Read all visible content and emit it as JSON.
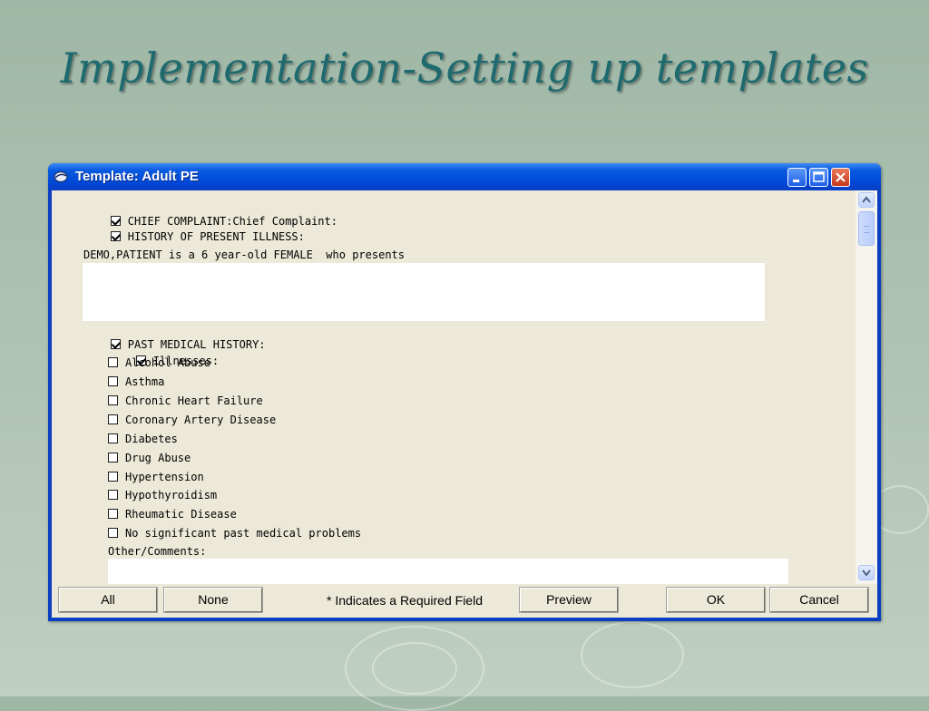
{
  "slide": {
    "title": "Implementation-Setting up templates"
  },
  "window": {
    "title": "Template: Adult PE",
    "controls": {
      "minimize_icon": "minimize-icon",
      "maximize_icon": "maximize-icon",
      "close_icon": "close-icon"
    }
  },
  "template": {
    "chief_complaint": {
      "label": "CHIEF COMPLAINT:Chief Complaint:",
      "checked": true
    },
    "hpi": {
      "label": "HISTORY OF PRESENT ILLNESS:",
      "checked": true,
      "intro": "DEMO,PATIENT is a 6 year-old FEMALE  who presents",
      "text_value": ""
    },
    "pmh": {
      "label": "PAST MEDICAL HISTORY:",
      "checked": true,
      "illnesses": {
        "label": "Illnesses:",
        "checked": true,
        "items": [
          {
            "label": "Alcohol Abuse",
            "checked": false
          },
          {
            "label": "Asthma",
            "checked": false
          },
          {
            "label": "Chronic Heart Failure",
            "checked": false
          },
          {
            "label": "Coronary Artery Disease",
            "checked": false
          },
          {
            "label": "Diabetes",
            "checked": false
          },
          {
            "label": "Drug Abuse",
            "checked": false
          },
          {
            "label": "Hypertension",
            "checked": false
          },
          {
            "label": "Hypothyroidism",
            "checked": false
          },
          {
            "label": "Rheumatic Disease",
            "checked": false
          },
          {
            "label": "No significant past medical problems",
            "checked": false
          }
        ]
      },
      "other_comments": {
        "label": "Other/Comments:",
        "value": ""
      }
    }
  },
  "buttons": {
    "all": "All",
    "none": "None",
    "required_note": "* Indicates a Required Field",
    "preview": "Preview",
    "ok": "OK",
    "cancel": "Cancel"
  },
  "colors": {
    "title_text": "#1e6a6e",
    "titlebar": "#0048d8",
    "client_bg": "#ece9d8"
  }
}
